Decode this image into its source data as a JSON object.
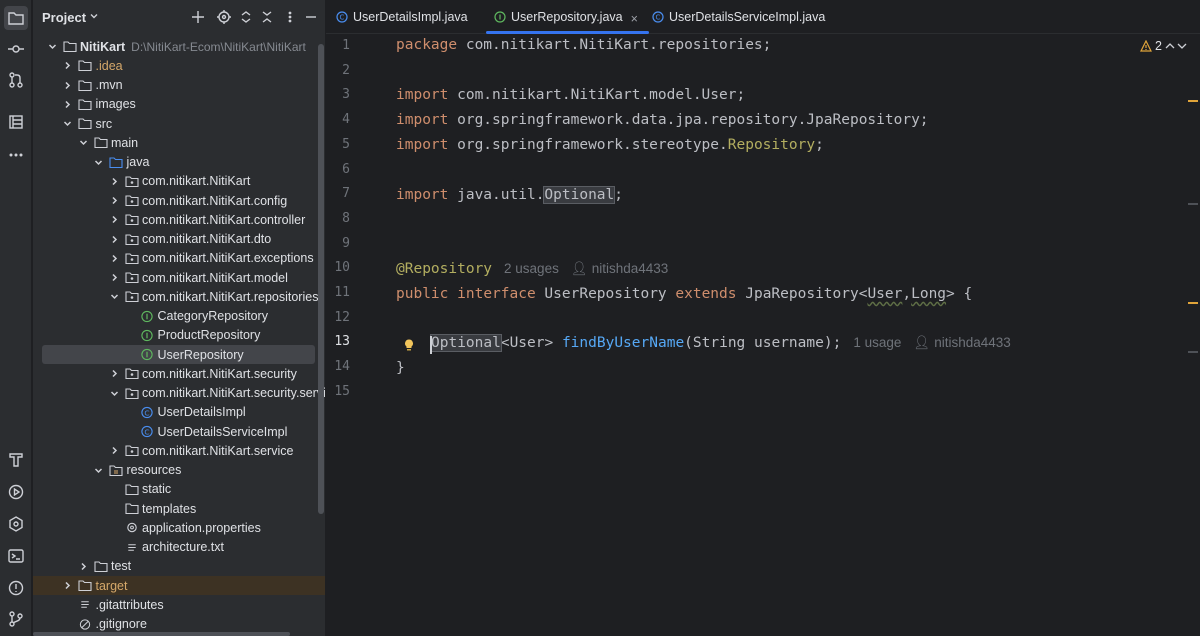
{
  "activity_bar": {
    "top_icons": [
      "folder-icon",
      "commit-icon",
      "pull-requests-icon",
      "structure-icon",
      "more-icon"
    ],
    "bottom_icons": [
      "services-icon",
      "run-icon",
      "plugins-icon",
      "terminal-icon",
      "problems-icon",
      "git-icon"
    ]
  },
  "project_panel": {
    "title": "Project",
    "tree": [
      {
        "label": "NitiKart",
        "hint": "D:\\NitiKart-Ecom\\NitiKart\\NitiKart",
        "depth": 0,
        "kind": "module",
        "expanded": true,
        "bold": true
      },
      {
        "label": ".idea",
        "depth": 1,
        "kind": "folder",
        "expanded": false,
        "ignored": true
      },
      {
        "label": ".mvn",
        "depth": 1,
        "kind": "folder",
        "expanded": false
      },
      {
        "label": "images",
        "depth": 1,
        "kind": "folder",
        "expanded": false
      },
      {
        "label": "src",
        "depth": 1,
        "kind": "folder",
        "expanded": true
      },
      {
        "label": "main",
        "depth": 2,
        "kind": "folder",
        "expanded": true
      },
      {
        "label": "java",
        "depth": 3,
        "kind": "source-folder",
        "expanded": true
      },
      {
        "label": "com.nitikart.NitiKart",
        "depth": 4,
        "kind": "package",
        "expanded": false
      },
      {
        "label": "com.nitikart.NitiKart.config",
        "depth": 4,
        "kind": "package",
        "expanded": false
      },
      {
        "label": "com.nitikart.NitiKart.controller",
        "depth": 4,
        "kind": "package",
        "expanded": false
      },
      {
        "label": "com.nitikart.NitiKart.dto",
        "depth": 4,
        "kind": "package",
        "expanded": false
      },
      {
        "label": "com.nitikart.NitiKart.exceptions",
        "depth": 4,
        "kind": "package",
        "expanded": false
      },
      {
        "label": "com.nitikart.NitiKart.model",
        "depth": 4,
        "kind": "package",
        "expanded": false
      },
      {
        "label": "com.nitikart.NitiKart.repositories",
        "depth": 4,
        "kind": "package",
        "expanded": true
      },
      {
        "label": "CategoryRepository",
        "depth": 5,
        "kind": "interface"
      },
      {
        "label": "ProductRepository",
        "depth": 5,
        "kind": "interface"
      },
      {
        "label": "UserRepository",
        "depth": 5,
        "kind": "interface",
        "selected": true
      },
      {
        "label": "com.nitikart.NitiKart.security",
        "depth": 4,
        "kind": "package",
        "expanded": false
      },
      {
        "label": "com.nitikart.NitiKart.security.service",
        "depth": 4,
        "kind": "package",
        "expanded": true
      },
      {
        "label": "UserDetailsImpl",
        "depth": 5,
        "kind": "class"
      },
      {
        "label": "UserDetailsServiceImpl",
        "depth": 5,
        "kind": "class"
      },
      {
        "label": "com.nitikart.NitiKart.service",
        "depth": 4,
        "kind": "package",
        "expanded": false
      },
      {
        "label": "resources",
        "depth": 3,
        "kind": "resources-folder",
        "expanded": true
      },
      {
        "label": "static",
        "depth": 4,
        "kind": "folder"
      },
      {
        "label": "templates",
        "depth": 4,
        "kind": "folder"
      },
      {
        "label": "application.properties",
        "depth": 4,
        "kind": "properties"
      },
      {
        "label": "architecture.txt",
        "depth": 4,
        "kind": "text"
      },
      {
        "label": "test",
        "depth": 2,
        "kind": "folder",
        "expanded": false
      },
      {
        "label": "target",
        "depth": 1,
        "kind": "folder",
        "expanded": false,
        "ignored": true,
        "excluded": true
      },
      {
        "label": ".gitattributes",
        "depth": 1,
        "kind": "text"
      },
      {
        "label": ".gitignore",
        "depth": 1,
        "kind": "gitignore"
      }
    ]
  },
  "tabs": [
    {
      "label": "UserDetailsImpl.java",
      "kind": "class"
    },
    {
      "label": "UserRepository.java",
      "kind": "interface",
      "active": true,
      "close": "×"
    },
    {
      "label": "UserDetailsServiceImpl.java",
      "kind": "class"
    }
  ],
  "editor": {
    "warning_count": "2",
    "current_line": 13,
    "line_numbers": [
      "1",
      "2",
      "3",
      "4",
      "5",
      "6",
      "7",
      "8",
      "9",
      "10",
      "11",
      "12",
      "13",
      "14",
      "15"
    ],
    "lines": {
      "l1": {
        "kw": "package",
        "rest": " com.nitikart.NitiKart.repositories;"
      },
      "l3": {
        "kw": "import",
        "rest": " com.nitikart.NitiKart.model.User;"
      },
      "l4": {
        "kw": "import",
        "rest": " org.springframework.data.jpa.repository.JpaRepository;"
      },
      "l5": {
        "kw": "import",
        "rest": " org.springframework.stereotype.",
        "ann": "Repository",
        "end": ";"
      },
      "l7": {
        "kw": "import",
        "rest": " java.util.",
        "box": "Optional",
        "end": ";"
      },
      "l10": {
        "ann": "@Repository",
        "inlay_usages": "2 usages",
        "inlay_author": "nitishda4433"
      },
      "l11": {
        "kw1": "public",
        "kw2": "interface",
        "name": " UserRepository ",
        "kw3": "extends",
        "rest1": " JpaRepository<",
        "u1": "User",
        "comma": ",",
        "u2": "Long",
        "rest2": "> {"
      },
      "l13": {
        "box": "Optional",
        "rest1": "<User> ",
        "fn": "findByUserName",
        "rest2": "(String username);",
        "inlay_usages": "1 usage",
        "inlay_author": "nitishda4433"
      },
      "l14": {
        "text": "}"
      }
    }
  },
  "colors": {
    "keyword": "#cf8e6d",
    "annotation": "#b3ae60",
    "function": "#56a8f5",
    "accent": "#3574f0",
    "interface_icon": "#5fb85f",
    "class_icon": "#4a8ef0"
  }
}
